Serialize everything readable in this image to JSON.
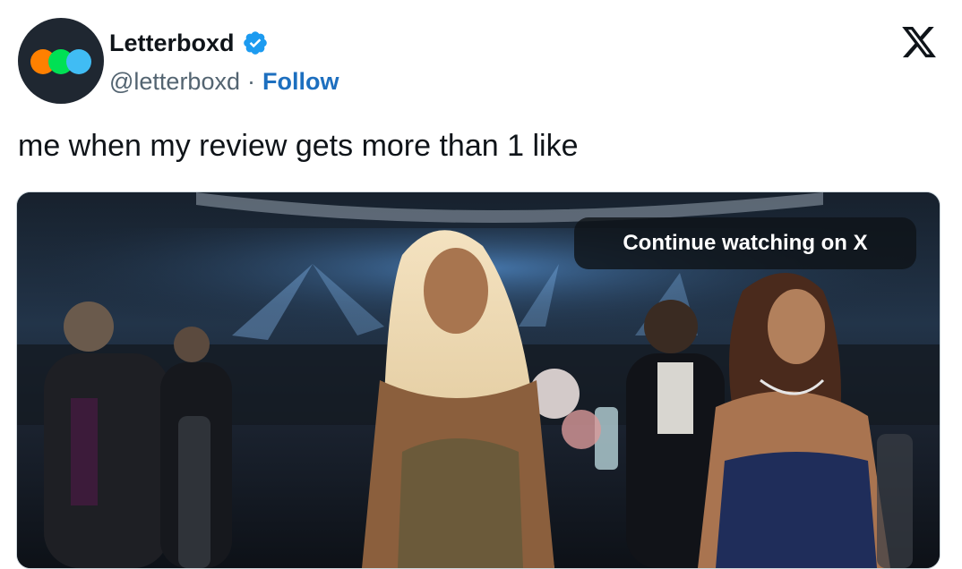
{
  "tweet": {
    "author": {
      "display_name": "Letterboxd",
      "handle": "@letterboxd",
      "separator": "·",
      "follow_label": "Follow",
      "verified": true
    },
    "text": "me when my review gets more than 1 like",
    "media": {
      "type": "video",
      "overlay_label": "Continue watching on X"
    }
  },
  "colors": {
    "follow_link": "#1d6fbf",
    "verified_badge": "#1d9bf0",
    "avatar_bg": "#1f2731",
    "logo_dots": [
      "#ff8000",
      "#00e054",
      "#40bcf4"
    ]
  },
  "icons": {
    "brand": "x-logo-icon",
    "badge": "verified-badge-icon"
  }
}
